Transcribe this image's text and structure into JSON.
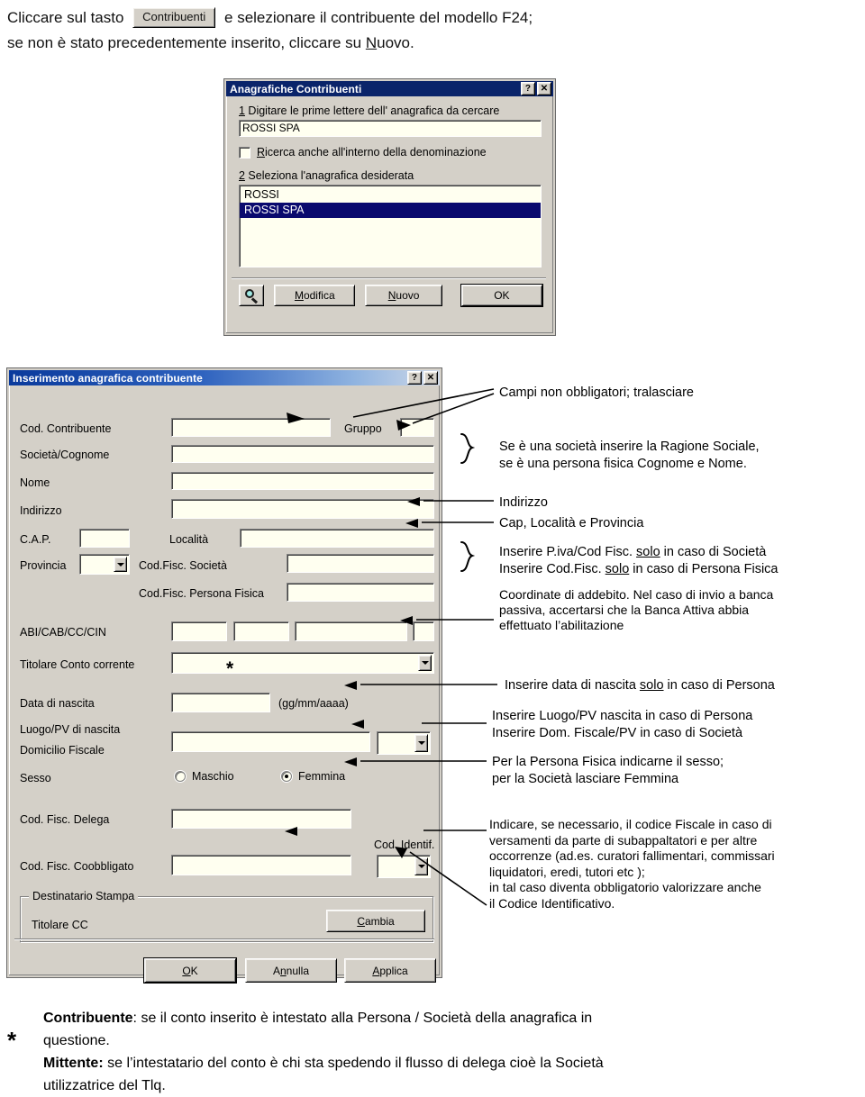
{
  "intro": {
    "line1_pre": "Cliccare sul tasto",
    "button_label": "Contribuenti",
    "line1_post": "e selezionare il contribuente del modello F24;",
    "line2_a": "se non è stato precedentemente inserito, cliccare su ",
    "line2_key": "N",
    "line2_b": "uovo."
  },
  "dialog1": {
    "title": "Anagrafiche Contribuenti",
    "help_button": "?",
    "close_button": "✕",
    "step1_num": "1",
    "step1_label": " Digitare le prime lettere dell' anagrafica da cercare",
    "search_value": "ROSSI SPA",
    "checkbox_key": "R",
    "checkbox_label": "icerca anche all'interno della denominazione",
    "step2_num": "2",
    "step2_label": " Seleziona l'anagrafica desiderata",
    "list_items": [
      {
        "text": "ROSSI",
        "selected": false
      },
      {
        "text": "ROSSI SPA",
        "selected": true
      }
    ],
    "search_icon": "magnifier-icon",
    "btn_modifica_key": "M",
    "btn_modifica_rest": "odifica",
    "btn_nuovo_key": "N",
    "btn_nuovo_rest": "uovo",
    "btn_ok": "OK"
  },
  "dialog2": {
    "title": "Inserimento anagrafica contribuente",
    "help_button": "?",
    "close_button": "✕",
    "labels": {
      "cod_contribuente": "Cod. Contribuente",
      "gruppo": "Gruppo",
      "societa_cognome": "Società/Cognome",
      "nome": "Nome",
      "indirizzo": "Indirizzo",
      "cap": "C.A.P.",
      "localita": "Località",
      "provincia": "Provincia",
      "cf_societa": "Cod.Fisc. Società",
      "cf_persona_fisica": "Cod.Fisc. Persona Fisica",
      "abi_cab_cc_cin": "ABI/CAB/CC/CIN",
      "titolare_cc": "Titolare Conto corrente",
      "data_nascita": "Data di nascita",
      "data_format": "(gg/mm/aaaa)",
      "luogo_pv": "Luogo/PV di nascita",
      "domicilio_fiscale": "Domicilio Fiscale",
      "sesso": "Sesso",
      "maschio": "Maschio",
      "femmina": "Femmina",
      "cf_delega": "Cod. Fisc. Delega",
      "cod_identif": "Cod. Identif.",
      "cf_coobbligato": "Cod. Fisc. Coobbligato",
      "destinatario_stampa": "Destinatario Stampa",
      "titolare_cc_value": "Titolare CC"
    },
    "values": {
      "titolare_cc_selected": "*",
      "sesso_selected": "femmina"
    },
    "buttons": {
      "cambia_key": "C",
      "cambia_rest": "ambia",
      "ok_key": "O",
      "ok_rest": "K",
      "annulla_a": "A",
      "annulla_key": "n",
      "annulla_rest": "nulla",
      "applica_key": "A",
      "applica_rest": "pplica"
    }
  },
  "annotations": {
    "a1": "Campi non obbligatori; tralasciare",
    "a2_l1": "Se è una società inserire la Ragione Sociale,",
    "a2_l2": "se è una persona fisica Cognome e Nome.",
    "a3": "Indirizzo",
    "a4": "Cap, Località e Provincia",
    "a5_l1_pre": "Inserire P.iva/Cod Fisc. ",
    "a5_l1_u": "solo",
    "a5_l1_post": " in caso di Società",
    "a5_l2_pre": "Inserire Cod.Fisc. ",
    "a5_l2_u": "solo",
    "a5_l2_post": " in caso di Persona Fisica",
    "a6_l1": "Coordinate di addebito. Nel caso di invio a banca",
    "a6_l2": "passiva, accertarsi che la Banca Attiva abbia",
    "a6_l3": "effettuato l’abilitazione",
    "a7_pre": "Inserire data di nascita ",
    "a7_u": "solo",
    "a7_post": " in caso di Persona",
    "a8_l1": "Inserire Luogo/PV nascita in caso di Persona",
    "a8_l2": "Inserire Dom. Fiscale/PV in caso di Società",
    "a9_l1": "Per la Persona Fisica indicarne il sesso;",
    "a9_l2": "per la Società lasciare Femmina",
    "a10_l1": "Indicare, se necessario, il codice Fiscale in caso di",
    "a10_l2": "versamenti da parte di subappaltatori e per altre",
    "a10_l3": "occorrenze (ad.es. curatori fallimentari, commissari",
    "a10_l4": "liquidatori, eredi, tutori etc );",
    "a10_l5": "   in tal caso diventa obbligatorio valorizzare anche",
    "a10_l6": "il Codice Identificativo."
  },
  "footnote": {
    "star": "*",
    "t1_bold": "Contribuente",
    "t1_rest": ": se il conto inserito è intestato alla Persona / Società della anagrafica in",
    "t2": "questione.",
    "t3_bold": "Mittente:",
    "t3_rest": " se l’intestatario del conto è chi sta spedendo il flusso di delega cioè la Società",
    "t4": "utilizzatrice del Tlq."
  },
  "colors": {
    "dialog_face": "#d4d0c8",
    "title_navy": "#0a246a",
    "field_bg": "#fffff0",
    "selection": "#0a0a6e"
  }
}
